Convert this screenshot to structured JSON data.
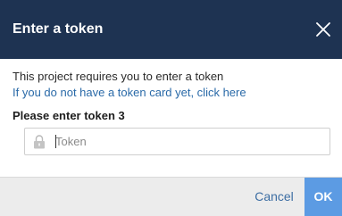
{
  "dialog": {
    "title": "Enter a token",
    "close_icon": "close-icon",
    "message": "This project requires you to enter a token",
    "link_text": "If you do not have a token card yet, click here",
    "field_label": "Please enter token 3",
    "input": {
      "placeholder": "Token",
      "value": "",
      "icon": "lock-icon"
    },
    "buttons": {
      "cancel_label": "Cancel",
      "ok_label": "OK"
    }
  },
  "colors": {
    "header_bg": "#1e3352",
    "link": "#2a6aa8",
    "cancel_text": "#3d6ea3",
    "ok_bg": "#5c9be3",
    "footer_bg": "#ececec"
  }
}
